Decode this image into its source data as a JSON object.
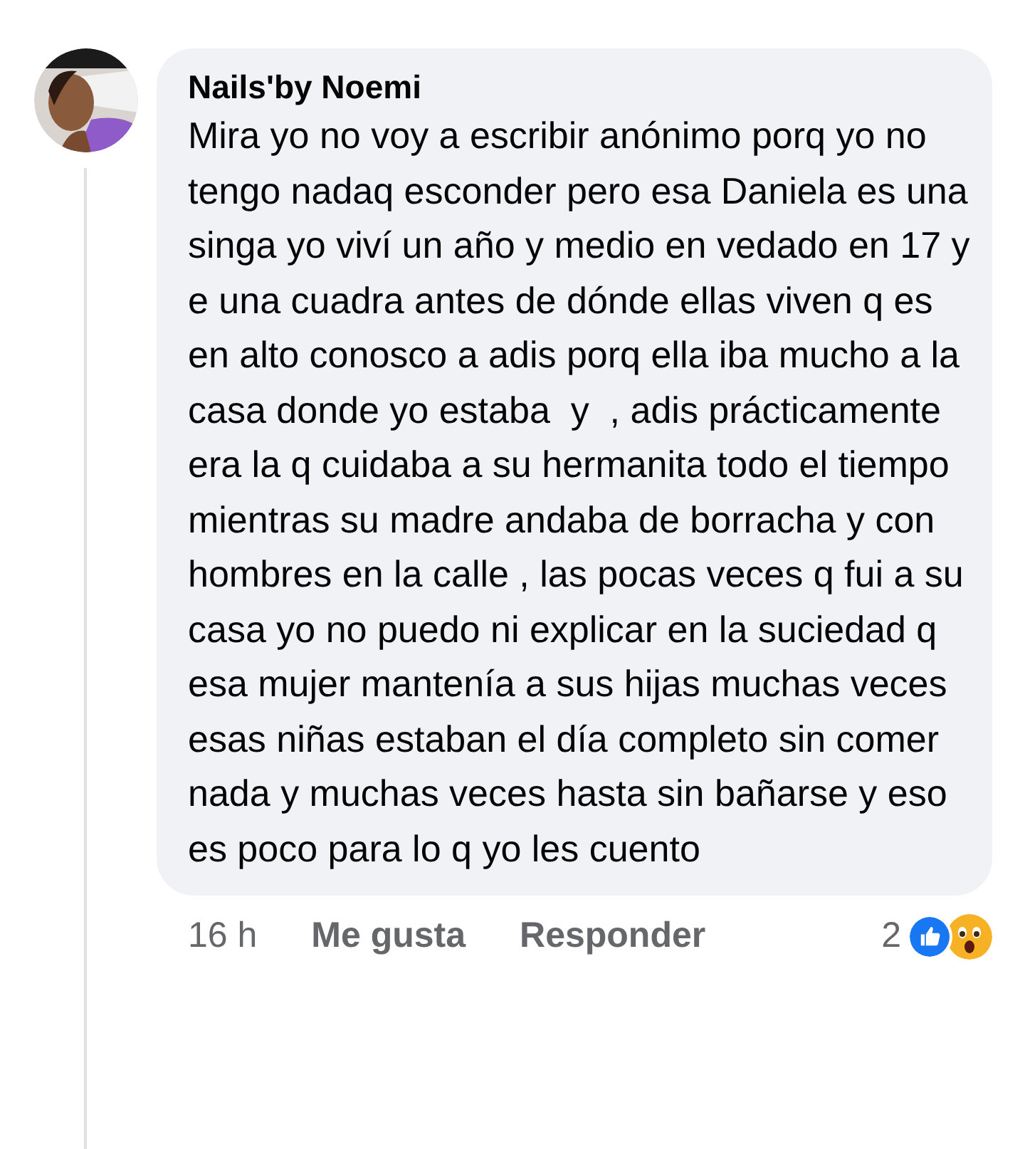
{
  "comment": {
    "author": "Nails'by Noemi",
    "text": "Mira yo no voy a escribir anónimo porq yo no tengo nadaq esconder pero esa Daniela es una singa yo viví un año y medio en vedado en 17 y e una cuadra antes de dónde ellas viven q es en alto conosco a adis porq ella iba mucho a la casa donde yo estaba  y  , adis prácticamente era la q cuidaba a su hermanita todo el tiempo mientras su madre andaba de borracha y con hombres en la calle , las pocas veces q fui a su casa yo no puedo ni explicar en la suciedad q esa mujer mantenía a sus hijas muchas veces esas niñas estaban el día completo sin comer nada y muchas veces hasta sin bañarse y eso es poco para lo q yo les cuento",
    "time": "16 h",
    "actions": [
      "Me gusta",
      "Responder"
    ],
    "reaction_count": "2",
    "reactions": [
      {
        "kind": "like"
      },
      {
        "kind": "wow"
      }
    ]
  }
}
